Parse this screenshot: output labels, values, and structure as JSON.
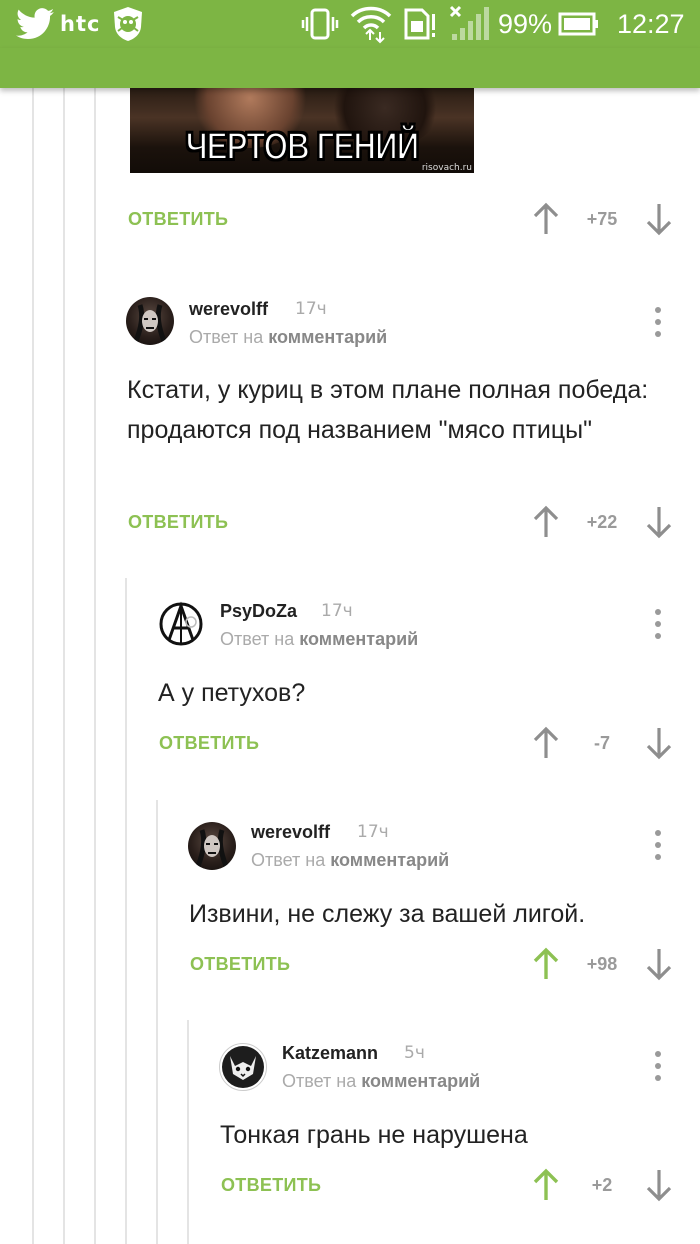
{
  "status_bar": {
    "carrier": "htc",
    "battery": "99%",
    "time": "12:27",
    "icons": [
      "twitter-icon",
      "htc-logo",
      "drweb-shield-icon",
      "vibrate-icon",
      "wifi-icon",
      "sim-icon",
      "signal-icon",
      "battery-icon"
    ]
  },
  "colors": {
    "accent": "#7db544",
    "reply": "#8dc153",
    "muted": "#aaaaaa"
  },
  "meme": {
    "caption": "ЧЕРТОВ ГЕНИЙ",
    "watermark": "risovach.ru"
  },
  "top_actions": {
    "reply_label": "ОТВЕТИТЬ",
    "score": "+75"
  },
  "comments": [
    {
      "author": "werevolff",
      "time": "17ч",
      "reply_prefix": "Ответ на",
      "reply_target": "комментарий",
      "text": "Кстати, у куриц в этом плане полная победа: продаются под названием \"мясо птицы\"",
      "reply_label": "ОТВЕТИТЬ",
      "score": "+22",
      "upvoted": false
    },
    {
      "author": "PsyDoZa",
      "time": "17ч",
      "reply_prefix": "Ответ на",
      "reply_target": "комментарий",
      "text": "А у петухов?",
      "reply_label": "ОТВЕТИТЬ",
      "score": "-7",
      "upvoted": false
    },
    {
      "author": "werevolff",
      "time": "17ч",
      "reply_prefix": "Ответ на",
      "reply_target": "комментарий",
      "text": "Извини, не слежу за вашей лигой.",
      "reply_label": "ОТВЕТИТЬ",
      "score": "+98",
      "upvoted": true
    },
    {
      "author": "Katzemann",
      "time": "5ч",
      "reply_prefix": "Ответ на",
      "reply_target": "комментарий",
      "text": "Тонкая грань не нарушена",
      "reply_label": "ОТВЕТИТЬ",
      "score": "+2",
      "upvoted": true
    }
  ]
}
